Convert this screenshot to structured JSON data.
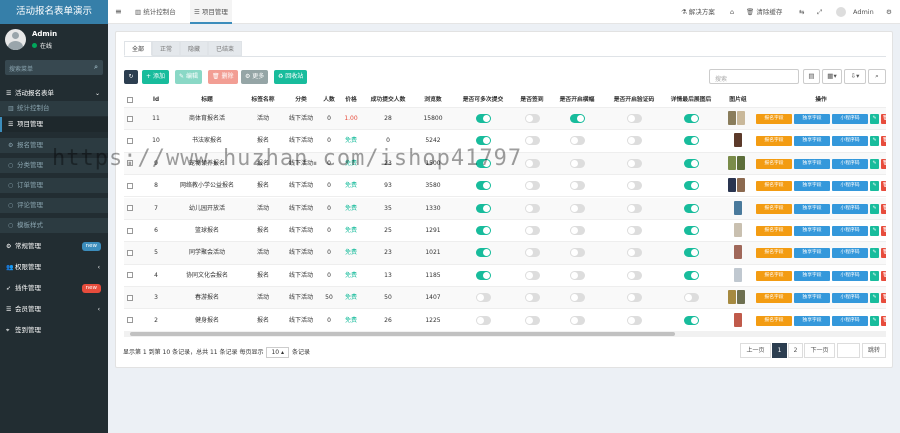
{
  "app": {
    "title": "活动报名表单演示"
  },
  "user": {
    "name": "Admin",
    "status": "在线"
  },
  "sidebar_search": {
    "placeholder": "搜索菜单"
  },
  "sidebar": {
    "items": [
      {
        "label": "活动报名表单",
        "icon": "list-icon",
        "arrow": "⌄"
      },
      {
        "label": "统计控制台",
        "icon": "chart-icon"
      },
      {
        "label": "项目管理",
        "icon": "list-icon"
      },
      {
        "label": "报名管理",
        "icon": "gear-icon"
      },
      {
        "label": "分类管理",
        "icon": "dot-icon"
      },
      {
        "label": "订单管理",
        "icon": "dot-icon"
      },
      {
        "label": "评论管理",
        "icon": "dot-icon"
      },
      {
        "label": "模板样式",
        "icon": "dot-icon"
      },
      {
        "label": "常规管理",
        "icon": "gear-icon",
        "badge": "new"
      },
      {
        "label": "权限管理",
        "icon": "users-icon",
        "arrow": "‹"
      },
      {
        "label": "插件管理",
        "icon": "rocket-icon",
        "badge": "new"
      },
      {
        "label": "会员管理",
        "icon": "list-icon",
        "arrow": "‹"
      },
      {
        "label": "签到管理",
        "icon": "map-pin-icon"
      }
    ]
  },
  "topbar": {
    "tabs": [
      {
        "label": "统计控制台"
      },
      {
        "label": "项目管理"
      }
    ],
    "right": {
      "solutions": "解决方案",
      "clear_cache": "清除缓存",
      "user": "Admin"
    }
  },
  "filter_tabs": [
    "全部",
    "正常",
    "隐藏",
    "已结束"
  ],
  "toolbar": {
    "add": "添加",
    "edit": "编辑",
    "delete": "删除",
    "more": "更多",
    "recycle": "回收站",
    "search_placeholder": "搜索"
  },
  "table": {
    "columns": [
      "Id",
      "标题",
      "标签名称",
      "分类",
      "人数",
      "价格",
      "成功提交人数",
      "浏览数",
      "是否可多次提交",
      "是否签到",
      "是否开启横幅",
      "是否开启验证码",
      "详情最后展图后",
      "图片组",
      "操作"
    ],
    "action_labels": [
      "报名字段",
      "独享字段",
      "小程序码"
    ],
    "rows": [
      {
        "id": "11",
        "title": "商体育报名活",
        "tag": "活动",
        "category": "线下活动",
        "people": "0",
        "price": "1.00",
        "success": "28",
        "views": "15800",
        "multi": true,
        "signin": false,
        "banner": true,
        "captcha": false,
        "detail": true
      },
      {
        "id": "10",
        "title": "书法家报名",
        "tag": "报名",
        "category": "线下活动",
        "people": "0",
        "price": "免费",
        "success": "0",
        "views": "5242",
        "multi": true,
        "signin": false,
        "banner": false,
        "captcha": false,
        "detail": true
      },
      {
        "id": "9",
        "title": "宠物领养报名",
        "tag": "报名",
        "category": "线下活动",
        "people": "0",
        "price": "免费",
        "success": "23",
        "views": "1500",
        "multi": true,
        "signin": false,
        "banner": false,
        "captcha": false,
        "detail": true
      },
      {
        "id": "8",
        "title": "网络教小学公益报名",
        "tag": "报名",
        "category": "线下活动",
        "people": "0",
        "price": "免费",
        "success": "93",
        "views": "3580",
        "multi": true,
        "signin": false,
        "banner": false,
        "captcha": false,
        "detail": true
      },
      {
        "id": "7",
        "title": "幼儿园开放活",
        "tag": "活动",
        "category": "线下活动",
        "people": "0",
        "price": "免费",
        "success": "35",
        "views": "1330",
        "multi": true,
        "signin": false,
        "banner": false,
        "captcha": false,
        "detail": true
      },
      {
        "id": "6",
        "title": "篮球报名",
        "tag": "报名",
        "category": "线下活动",
        "people": "0",
        "price": "免费",
        "success": "25",
        "views": "1291",
        "multi": true,
        "signin": false,
        "banner": false,
        "captcha": false,
        "detail": true
      },
      {
        "id": "5",
        "title": "同学聚会活动",
        "tag": "活动",
        "category": "线下活动",
        "people": "0",
        "price": "免费",
        "success": "23",
        "views": "1021",
        "multi": true,
        "signin": false,
        "banner": false,
        "captcha": false,
        "detail": true
      },
      {
        "id": "4",
        "title": "协同文化会报名",
        "tag": "报名",
        "category": "线下活动",
        "people": "0",
        "price": "免费",
        "success": "13",
        "views": "1185",
        "multi": true,
        "signin": false,
        "banner": false,
        "captcha": false,
        "detail": true
      },
      {
        "id": "3",
        "title": "春游报名",
        "tag": "活动",
        "category": "线下活动",
        "people": "50",
        "price": "免费",
        "success": "50",
        "views": "1407",
        "multi": false,
        "signin": false,
        "banner": false,
        "captcha": false,
        "detail": false
      },
      {
        "id": "2",
        "title": "健身报名",
        "tag": "报名",
        "category": "线下活动",
        "people": "0",
        "price": "免费",
        "success": "26",
        "views": "1225",
        "multi": false,
        "signin": false,
        "banner": false,
        "captcha": false,
        "detail": true
      }
    ]
  },
  "pagination": {
    "info_prefix": "显示第 1 到第 10 条记录，总共 11 条记录 每页显示",
    "page_size": "10",
    "info_suffix": "条记录",
    "prev": "上一页",
    "pages": [
      "1",
      "2"
    ],
    "next": "下一页",
    "jump": "跳转"
  },
  "watermark": "https://www.huzhan.com/ishop41797",
  "colors": {
    "primary": "#3c8dbc",
    "success": "#18bc9c",
    "warning": "#f39c12",
    "danger": "#e74c3c",
    "info": "#3498db"
  }
}
